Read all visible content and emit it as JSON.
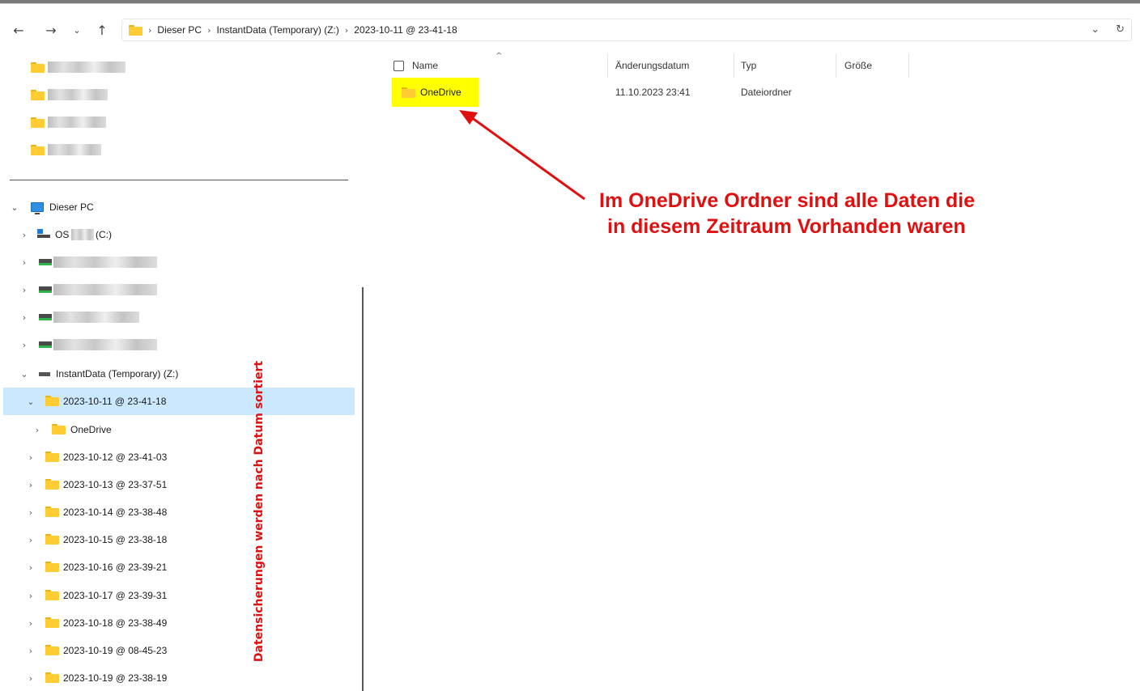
{
  "window": {
    "accent_color": "#cce8ff",
    "annotation_color": "#e01010",
    "highlight_color": "#ffff00"
  },
  "navigation": {
    "back_icon": "arrow-left-icon",
    "forward_icon": "arrow-right-icon",
    "recent_icon": "chevron-down-icon",
    "up_icon": "arrow-up-icon"
  },
  "address_bar": {
    "breadcrumbs": [
      "Dieser PC",
      "InstantData (Temporary) (Z:)",
      "2023-10-11 @ 23-41-18"
    ],
    "dropdown_icon": "chevron-down-icon",
    "refresh_icon": "refresh-icon"
  },
  "sidebar": {
    "quick_access_count_blurred": 4,
    "this_pc": "Dieser PC",
    "os_drive_prefix": "OS",
    "os_drive_suffix": "(C:)",
    "instant_data_drive": "InstantData (Temporary) (Z:)",
    "selected_folder": "2023-10-11 @ 23-41-18",
    "selected_child": "OneDrive",
    "backup_folders": [
      "2023-10-12 @ 23-41-03",
      "2023-10-13 @ 23-37-51",
      "2023-10-14 @ 23-38-48",
      "2023-10-15 @ 23-38-18",
      "2023-10-16 @ 23-39-21",
      "2023-10-17 @ 23-39-31",
      "2023-10-18 @ 23-38-49",
      "2023-10-19 @ 08-45-23",
      "2023-10-19 @ 23-38-19"
    ],
    "vertical_annotation": "Datensicherungen werden nach Datum sortiert"
  },
  "content": {
    "columns": {
      "name": "Name",
      "date": "Änderungsdatum",
      "type": "Typ",
      "size": "Größe"
    },
    "rows": [
      {
        "name": "OneDrive",
        "date": "11.10.2023 23:41",
        "type": "Dateiordner",
        "size": ""
      }
    ]
  },
  "annotation": {
    "line1": "Im OneDrive Ordner sind alle Daten die",
    "line2": "in diesem Zeitraum Vorhanden waren"
  }
}
